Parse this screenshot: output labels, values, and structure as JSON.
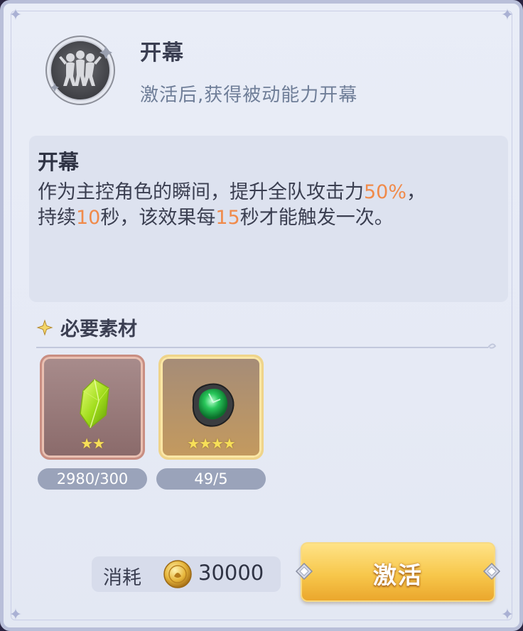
{
  "skill": {
    "title": "开幕",
    "subtitle": "激活后,获得被动能力开幕",
    "icon": "party-dance-icon"
  },
  "description": {
    "title": "开幕",
    "line1_pre": "作为主控角色的瞬间，提升全队攻击力",
    "line1_value": "50%",
    "line1_post": "，",
    "line2_pre": "持续",
    "line2_value1": "10",
    "line2_mid": "秒，该效果每",
    "line2_value2": "15",
    "line2_post": "秒才能触发一次。"
  },
  "materials": {
    "header": "必要素材",
    "items": [
      {
        "icon": "green-crystal-shard-icon",
        "stars": "★★",
        "count": "2980/300"
      },
      {
        "icon": "emerald-ore-icon",
        "stars": "★★★★",
        "count": "49/5"
      }
    ]
  },
  "cost": {
    "label": "消耗",
    "icon": "gold-coin-icon",
    "value": "30000"
  },
  "button": {
    "label": "激活"
  },
  "colors": {
    "highlight": "#f08a4a",
    "panel": "#e9edf7",
    "button_gold": "#f7c74b"
  }
}
